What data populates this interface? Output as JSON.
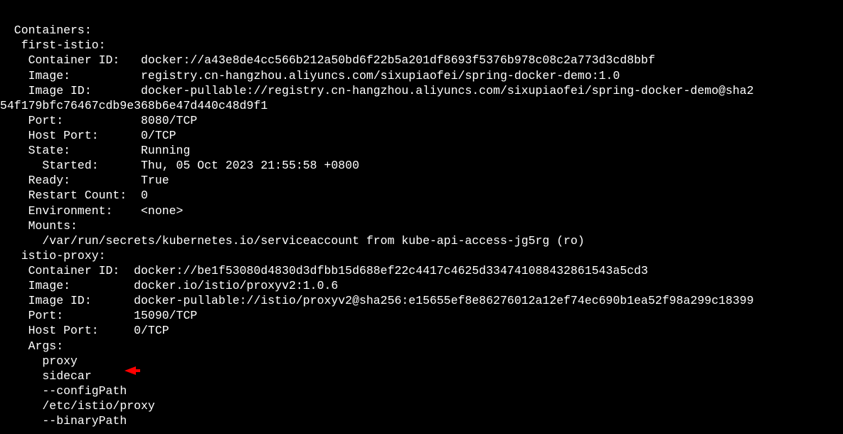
{
  "lines": {
    "l0": "",
    "l1": "  Containers:",
    "l2": "   first-istio:",
    "l3": "    Container ID:   docker://a43e8de4cc566b212a50bd6f22b5a201df8693f5376b978c08c2a773d3cd8bbf",
    "l4": "    Image:          registry.cn-hangzhou.aliyuncs.com/sixupiaofei/spring-docker-demo:1.0",
    "l5": "    Image ID:       docker-pullable://registry.cn-hangzhou.aliyuncs.com/sixupiaofei/spring-docker-demo@sha2",
    "l6": "54f179bfc76467cdb9e368b6e47d440c48d9f1",
    "l7": "    Port:           8080/TCP",
    "l8": "    Host Port:      0/TCP",
    "l9": "    State:          Running",
    "l10": "      Started:      Thu, 05 Oct 2023 21:55:58 +0800",
    "l11": "    Ready:          True",
    "l12": "    Restart Count:  0",
    "l13": "    Environment:    <none>",
    "l14": "    Mounts:",
    "l15": "      /var/run/secrets/kubernetes.io/serviceaccount from kube-api-access-jg5rg (ro)",
    "l16": "   istio-proxy:",
    "l17": "    Container ID:  docker://be1f53080d4830d3dfbb15d688ef22c4417c4625d334741088432861543a5cd3",
    "l18": "    Image:         docker.io/istio/proxyv2:1.0.6",
    "l19": "    Image ID:      docker-pullable://istio/proxyv2@sha256:e15655ef8e86276012a12ef74ec690b1ea52f98a299c18399",
    "l20": "    Port:          15090/TCP",
    "l21": "    Host Port:     0/TCP",
    "l22": "    Args:",
    "l23": "      proxy",
    "l24": "      sidecar",
    "l25": "      --configPath",
    "l26": "      /etc/istio/proxy",
    "l27": "      --binaryPath"
  }
}
